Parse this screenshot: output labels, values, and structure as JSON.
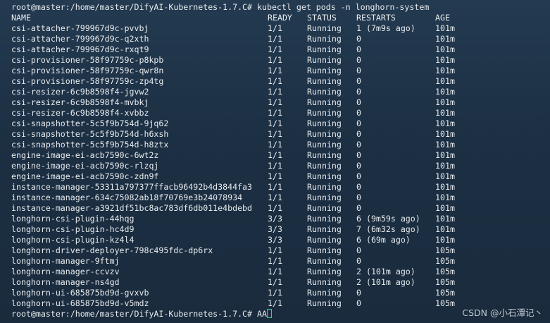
{
  "terminal": {
    "prompt": "root@master:/home/master/DifyAI-Kubernetes-1.7.C#",
    "command": "kubectl get pods -n longhorn-system",
    "final_input": "AA",
    "headers": {
      "name": "NAME",
      "ready": "READY",
      "status": "STATUS",
      "restarts": "RESTARTS",
      "age": "AGE"
    },
    "rows": [
      {
        "name": "csi-attacher-799967d9c-pvvbj",
        "ready": "1/1",
        "status": "Running",
        "restarts": "1 (7m9s ago)",
        "age": "101m"
      },
      {
        "name": "csi-attacher-799967d9c-q2xth",
        "ready": "1/1",
        "status": "Running",
        "restarts": "0",
        "age": "101m"
      },
      {
        "name": "csi-attacher-799967d9c-rxqt9",
        "ready": "1/1",
        "status": "Running",
        "restarts": "0",
        "age": "101m"
      },
      {
        "name": "csi-provisioner-58f97759c-p8kpb",
        "ready": "1/1",
        "status": "Running",
        "restarts": "0",
        "age": "101m"
      },
      {
        "name": "csi-provisioner-58f97759c-qwr8n",
        "ready": "1/1",
        "status": "Running",
        "restarts": "0",
        "age": "101m"
      },
      {
        "name": "csi-provisioner-58f97759c-zp4tg",
        "ready": "1/1",
        "status": "Running",
        "restarts": "0",
        "age": "101m"
      },
      {
        "name": "csi-resizer-6c9b8598f4-jgvw2",
        "ready": "1/1",
        "status": "Running",
        "restarts": "0",
        "age": "101m"
      },
      {
        "name": "csi-resizer-6c9b8598f4-mvbkj",
        "ready": "1/1",
        "status": "Running",
        "restarts": "0",
        "age": "101m"
      },
      {
        "name": "csi-resizer-6c9b8598f4-xvbbz",
        "ready": "1/1",
        "status": "Running",
        "restarts": "0",
        "age": "101m"
      },
      {
        "name": "csi-snapshotter-5c5f9b754d-9jq62",
        "ready": "1/1",
        "status": "Running",
        "restarts": "0",
        "age": "101m"
      },
      {
        "name": "csi-snapshotter-5c5f9b754d-h6xsh",
        "ready": "1/1",
        "status": "Running",
        "restarts": "0",
        "age": "101m"
      },
      {
        "name": "csi-snapshotter-5c5f9b754d-h8ztx",
        "ready": "1/1",
        "status": "Running",
        "restarts": "0",
        "age": "101m"
      },
      {
        "name": "engine-image-ei-acb7590c-6wt2z",
        "ready": "1/1",
        "status": "Running",
        "restarts": "0",
        "age": "101m"
      },
      {
        "name": "engine-image-ei-acb7590c-rlzqj",
        "ready": "1/1",
        "status": "Running",
        "restarts": "0",
        "age": "101m"
      },
      {
        "name": "engine-image-ei-acb7590c-zdn9f",
        "ready": "1/1",
        "status": "Running",
        "restarts": "0",
        "age": "101m"
      },
      {
        "name": "instance-manager-53311a797377ffacb96492b4d3844fa3",
        "ready": "1/1",
        "status": "Running",
        "restarts": "0",
        "age": "101m"
      },
      {
        "name": "instance-manager-634c75082ab18f70769e3b24078934",
        "ready": "1/1",
        "status": "Running",
        "restarts": "0",
        "age": "101m"
      },
      {
        "name": "instance-manager-a3921df51bc8ac783df6db011e4bdebd",
        "ready": "1/1",
        "status": "Running",
        "restarts": "0",
        "age": "101m"
      },
      {
        "name": "longhorn-csi-plugin-44hqg",
        "ready": "3/3",
        "status": "Running",
        "restarts": "6 (9m59s ago)",
        "age": "101m"
      },
      {
        "name": "longhorn-csi-plugin-hc4d9",
        "ready": "3/3",
        "status": "Running",
        "restarts": "7 (6m32s ago)",
        "age": "101m"
      },
      {
        "name": "longhorn-csi-plugin-kz4l4",
        "ready": "3/3",
        "status": "Running",
        "restarts": "6 (69m ago)",
        "age": "101m"
      },
      {
        "name": "longhorn-driver-deployer-798c495fdc-dp6rx",
        "ready": "1/1",
        "status": "Running",
        "restarts": "0",
        "age": "105m"
      },
      {
        "name": "longhorn-manager-9ftmj",
        "ready": "1/1",
        "status": "Running",
        "restarts": "0",
        "age": "105m"
      },
      {
        "name": "longhorn-manager-ccvzv",
        "ready": "1/1",
        "status": "Running",
        "restarts": "2 (101m ago)",
        "age": "105m"
      },
      {
        "name": "longhorn-manager-ns4gd",
        "ready": "1/1",
        "status": "Running",
        "restarts": "2 (101m ago)",
        "age": "105m"
      },
      {
        "name": "longhorn-ui-685875bd9d-gvxvb",
        "ready": "1/1",
        "status": "Running",
        "restarts": "0",
        "age": "105m"
      },
      {
        "name": "longhorn-ui-685875bd9d-v5mdz",
        "ready": "1/1",
        "status": "Running",
        "restarts": "0",
        "age": "105m"
      }
    ]
  },
  "watermark": "CSDN @小石潭记丶",
  "colors": {
    "background": "#1f3347",
    "text": "#e8ecef",
    "cursor": "#3fd07a"
  }
}
